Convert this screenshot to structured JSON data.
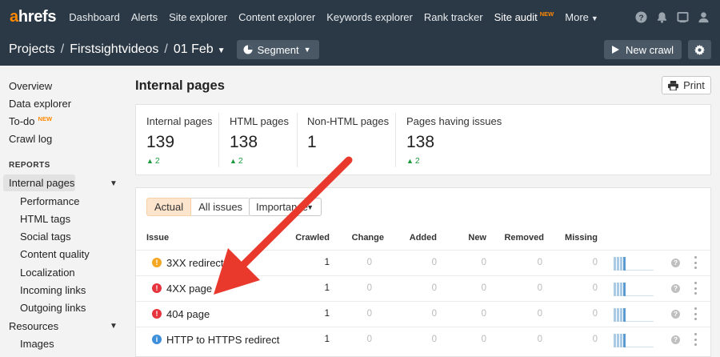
{
  "nav": {
    "logo_a": "a",
    "logo_rest": "hrefs",
    "links": [
      {
        "label": "Dashboard"
      },
      {
        "label": "Alerts"
      },
      {
        "label": "Site explorer"
      },
      {
        "label": "Content explorer"
      },
      {
        "label": "Keywords explorer"
      },
      {
        "label": "Rank tracker"
      },
      {
        "label": "Site audit",
        "badge": "NEW"
      },
      {
        "label": "More"
      }
    ],
    "icons": [
      "help-icon",
      "bell-icon",
      "window-icon",
      "user-icon"
    ]
  },
  "project_bar": {
    "crumbs": [
      "Projects",
      "Firstsightvideos",
      "01 Feb"
    ],
    "segment_label": "Segment",
    "new_crawl_label": "New crawl"
  },
  "sidebar": {
    "overview": "Overview",
    "data_explorer": "Data explorer",
    "todo": "To-do",
    "todo_badge": "NEW",
    "crawl_log": "Crawl log",
    "reports_header": "REPORTS",
    "internal_pages": "Internal pages",
    "sub_items": [
      "Performance",
      "HTML tags",
      "Social tags",
      "Content quality",
      "Localization",
      "Incoming links",
      "Outgoing links"
    ],
    "resources": "Resources",
    "images": "Images"
  },
  "main": {
    "title": "Internal pages",
    "print_label": "Print",
    "stats": [
      {
        "label": "Internal pages",
        "value": "139",
        "delta": "2"
      },
      {
        "label": "HTML pages",
        "value": "138",
        "delta": "2"
      },
      {
        "label": "Non-HTML pages",
        "value": "1",
        "delta": ""
      },
      {
        "label": "Pages having issues",
        "value": "138",
        "delta": "2"
      }
    ],
    "tabs": {
      "actual": "Actual",
      "all": "All issues"
    },
    "importance_label": "Importance",
    "columns": {
      "issue": "Issue",
      "crawled": "Crawled",
      "change": "Change",
      "added": "Added",
      "new": "New",
      "removed": "Removed",
      "missing": "Missing"
    },
    "rows": [
      {
        "name": "3XX redirect",
        "severity": "warning",
        "crawled": "1",
        "change": "0",
        "added": "0",
        "new": "0",
        "removed": "0",
        "missing": "0"
      },
      {
        "name": "4XX page",
        "severity": "error",
        "crawled": "1",
        "change": "0",
        "added": "0",
        "new": "0",
        "removed": "0",
        "missing": "0"
      },
      {
        "name": "404 page",
        "severity": "error",
        "crawled": "1",
        "change": "0",
        "added": "0",
        "new": "0",
        "removed": "0",
        "missing": "0"
      },
      {
        "name": "HTTP to HTTPS redirect",
        "severity": "info",
        "crawled": "1",
        "change": "0",
        "added": "0",
        "new": "0",
        "removed": "0",
        "missing": "0"
      }
    ]
  },
  "colors": {
    "nav_bg": "#2b3845",
    "brand_orange": "#ff8800",
    "arrow_red": "#e8392c",
    "positive_green": "#1a9a3a",
    "spark_bar": "#a9cbe6"
  }
}
